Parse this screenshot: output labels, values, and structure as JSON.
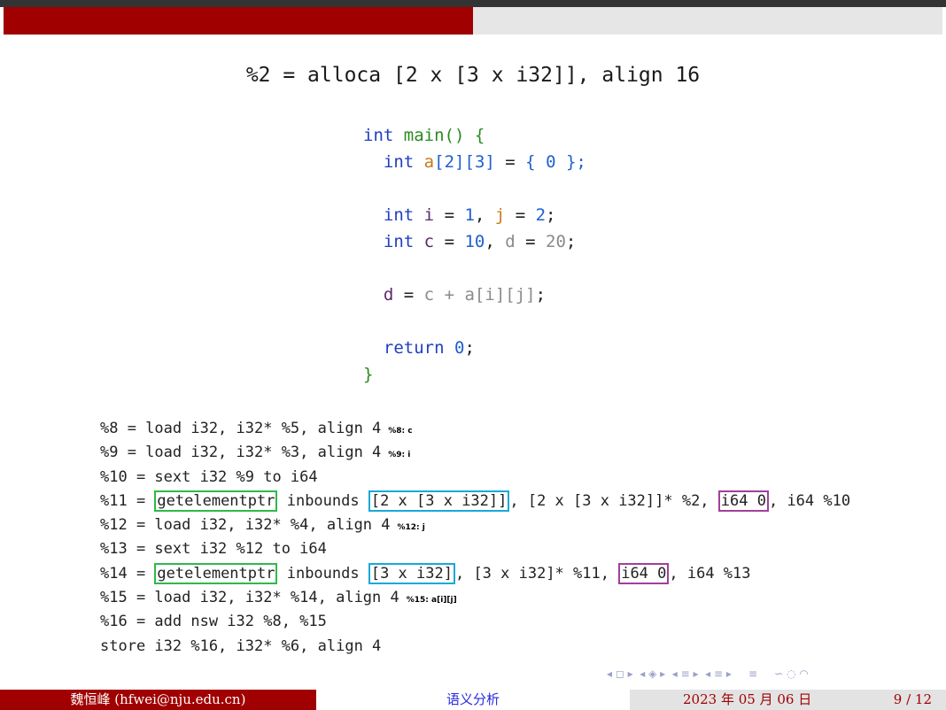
{
  "slide_title": "%2 = alloca [2 x [3 x i32]], align 16",
  "code": {
    "kw_int": "int",
    "fn_main": "main",
    "open_brace_text": "() {",
    "var_a": "a",
    "lb": "[",
    "rb": "]",
    "n2": "2",
    "n3": "3",
    "n0": "0",
    "eq": " = ",
    "init_open": "{ ",
    "init_close": " };",
    "var_i": "i",
    "n1": "1",
    "comma": ", ",
    "var_j": "j",
    "semi": ";",
    "var_c": "c",
    "n10": "10",
    "var_d": "d",
    "n20": "20",
    "plus": " + ",
    "kw_return": "return",
    "close_brace": "}"
  },
  "ir": {
    "line8": "%8 = load i32, i32* %5, align 4",
    "ann8": "%8: c",
    "line9": "%9 = load i32, i32* %3, align 4",
    "ann9": "%9: i",
    "line10": "%10 = sext i32 %9 to i64",
    "line11_a": "%11 = ",
    "gep": "getelementptr",
    "inbounds": " inbounds ",
    "line11_type": "[2 x [3 x i32]]",
    "line11_b": ", [2 x [3 x i32]]* %2, ",
    "i64_0": "i64 0",
    "line11_c": ", i64 %10",
    "line12": "%12 = load i32, i32* %4, align 4",
    "ann12": "%12: j",
    "line13": "%13 = sext i32 %12 to i64",
    "line14_a": "%14 = ",
    "line14_type": "[3 x i32]",
    "line14_b": ", [3 x i32]* %11, ",
    "line14_c": ", i64 %13",
    "line15": "%15 = load i32, i32* %14, align 4",
    "ann15": "%15: a[i][j]",
    "line16": "%16 = add nsw i32 %8, %15",
    "line_store": "store i32 %16, i32* %6, align 4"
  },
  "nav": "◂ ◻ ▸  ◂ ◈ ▸  ◂ ≡ ▸  ◂ ≡ ▸     ≡     ∽ ◌ ◠",
  "footer": {
    "author": "魏恒峰  (hfwei@nju.edu.cn)",
    "section": "语义分析",
    "date": "2023 年 05 月 06 日",
    "page": "9 / 12"
  },
  "colors": {
    "header_red": "#a00000",
    "header_gray": "#e6e6e6",
    "box_green": "#2fb94a",
    "box_blue": "#19a9d8",
    "box_purple": "#a0409a"
  }
}
